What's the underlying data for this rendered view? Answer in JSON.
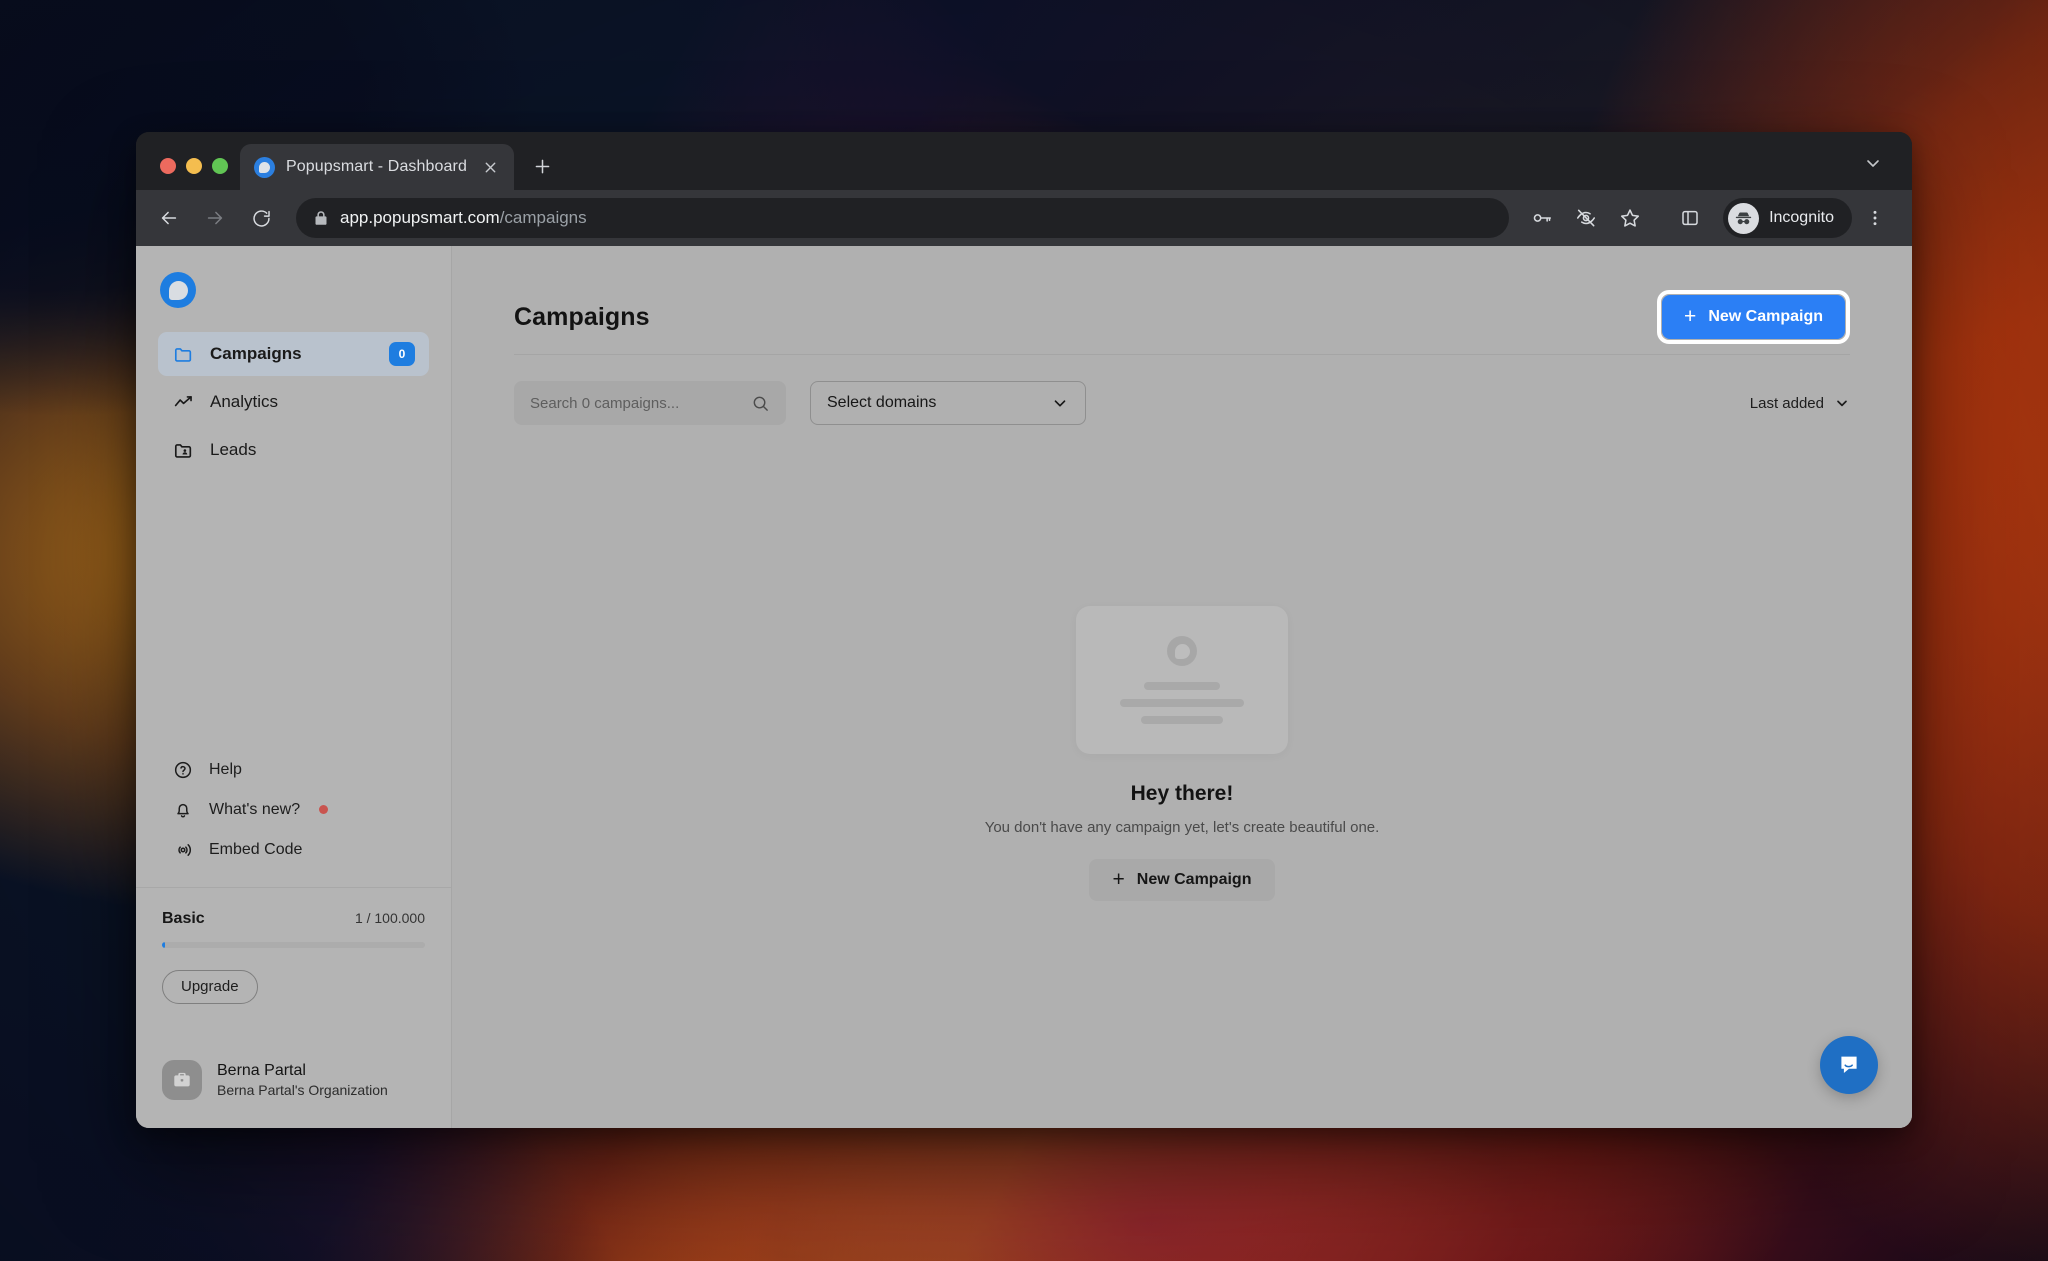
{
  "browser": {
    "tab": {
      "title": "Popupsmart - Dashboard",
      "favicon_icon": "popupsmart-logo-icon",
      "close_icon": "close-icon"
    },
    "new_tab_icon": "plus-icon",
    "tab_list_chevron_icon": "chevron-down-icon",
    "nav": {
      "back_icon": "arrow-left-icon",
      "forward_icon": "arrow-right-icon",
      "reload_icon": "reload-icon"
    },
    "omnibox": {
      "lock_icon": "lock-icon",
      "url_host": "app.popupsmart.com",
      "url_path": "/campaigns"
    },
    "toolbar_right": {
      "password_icon": "key-icon",
      "tracking_protection_icon": "eye-off-icon",
      "bookmark_icon": "star-icon",
      "side_panel_icon": "side-panel-icon",
      "profile_icon": "incognito-icon",
      "profile_label": "Incognito",
      "menu_icon": "three-dots-icon"
    },
    "traffic_lights": {
      "close": "close-window-button",
      "minimize": "minimize-window-button",
      "maximize": "maximize-window-button"
    }
  },
  "sidebar": {
    "brand_icon": "popupsmart-logo-icon",
    "nav": [
      {
        "label": "Campaigns",
        "icon": "folder-icon",
        "badge": "0",
        "active": true
      },
      {
        "label": "Analytics",
        "icon": "line-chart-icon",
        "active": false
      },
      {
        "label": "Leads",
        "icon": "folder-user-icon",
        "active": false
      }
    ],
    "secondary": [
      {
        "label": "Help",
        "icon": "question-circle-icon",
        "dot": false
      },
      {
        "label": "What's new?",
        "icon": "bell-icon",
        "dot": true
      },
      {
        "label": "Embed Code",
        "icon": "embed-code-icon",
        "dot": false
      }
    ],
    "plan": {
      "name": "Basic",
      "quota": "1 / 100.000",
      "progress_percent": 1,
      "upgrade_label": "Upgrade"
    },
    "user": {
      "avatar_icon": "briefcase-icon",
      "name": "Berna Partal",
      "organization": "Berna Partal's Organization"
    }
  },
  "main": {
    "title": "Campaigns",
    "new_campaign_label": "New Campaign",
    "new_campaign_icon": "plus-icon",
    "search": {
      "placeholder": "Search 0 campaigns...",
      "value": "",
      "icon": "search-icon"
    },
    "domain_select": {
      "value": "Select domains",
      "chevron_icon": "chevron-down-icon"
    },
    "sort": {
      "value": "Last added",
      "chevron_icon": "chevron-down-icon"
    },
    "empty_state": {
      "placeholder_logo_icon": "popupsmart-logo-icon",
      "title": "Hey there!",
      "subtitle": "You don't have any campaign yet, let's create beautiful one.",
      "button_label": "New Campaign",
      "button_icon": "plus-icon"
    },
    "intercom": {
      "icon": "chat-bubble-icon"
    }
  },
  "colors": {
    "accent_blue": "#2b7ff5",
    "brand_blue": "#1e7de0",
    "badge_blue": "#1e7de0",
    "notification_red": "#c9544f",
    "intercom_blue": "#1f6fc4"
  }
}
